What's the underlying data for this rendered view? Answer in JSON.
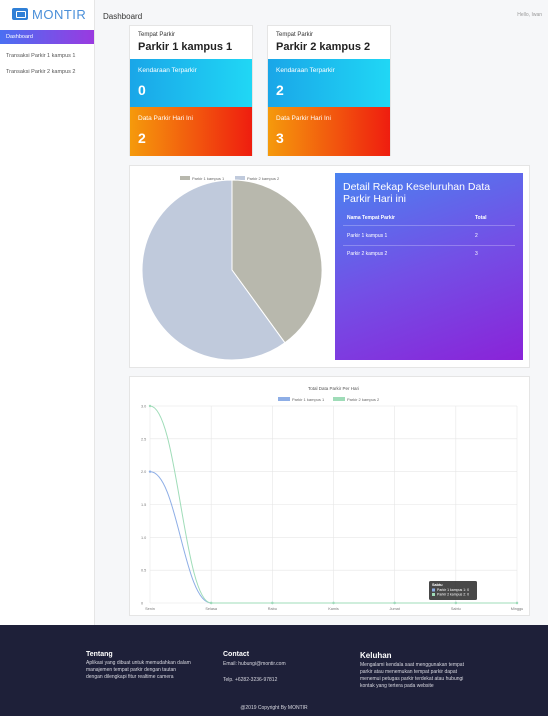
{
  "brand": {
    "name": "MONTIR"
  },
  "sidebar": {
    "items": [
      {
        "label": "Dashboard"
      },
      {
        "label": "Transaksi Parkir 1 kampus 1"
      },
      {
        "label": "Transaksi Parkir 2 kampus 2"
      }
    ]
  },
  "header": {
    "title": "Dashboard",
    "user": "Hello, Iwan"
  },
  "cards": [
    {
      "label": "Tempat Parkir",
      "name": "Parkir 1 kampus 1",
      "terparkir_label": "Kendaraan Terparkir",
      "terparkir": "0",
      "hari_ini_label": "Data Parkir Hari Ini",
      "hari_ini": "2"
    },
    {
      "label": "Tempat Parkir",
      "name": "Parkir 2 kampus 2",
      "terparkir_label": "Kendaraan Terparkir",
      "terparkir": "2",
      "hari_ini_label": "Data Parkir Hari Ini",
      "hari_ini": "3"
    }
  ],
  "rekap": {
    "title": "Detail Rekap Keseluruhan Data Parkir Hari ini",
    "col_name": "Nama Tempat Parkir",
    "col_total": "Total",
    "rows": [
      {
        "name": "Parkir 1 kampus 1",
        "total": "2"
      },
      {
        "name": "Parkir 2 kampus 2",
        "total": "3"
      }
    ]
  },
  "chart_data": [
    {
      "type": "pie",
      "categories": [
        "Parkir 1 kampus 1",
        "Parkir 2 kampus 2"
      ],
      "values": [
        2,
        3
      ],
      "colors": [
        "#b8b8ad",
        "#c0cadc"
      ],
      "legend": "top"
    },
    {
      "type": "line",
      "title": "Total Data Parkir Per Hari",
      "x": [
        "Senin",
        "Selasa",
        "Rabu",
        "Kamis",
        "Jumat",
        "Sabtu",
        "Minggu"
      ],
      "ylim": [
        0,
        3
      ],
      "yticks": [
        "0",
        "0.5",
        "1.0",
        "1.5",
        "2.0",
        "2.5",
        "3.0"
      ],
      "series": [
        {
          "name": "Parkir 1 kampus 1",
          "values": [
            2,
            0,
            0,
            0,
            0,
            0,
            0
          ],
          "color": "#8eaee6"
        },
        {
          "name": "Parkir 2 kampus 2",
          "values": [
            3,
            0,
            0,
            0,
            0,
            0,
            0
          ],
          "color": "#9fdcb8"
        }
      ],
      "tooltip": {
        "title": "Sabtu",
        "lines": [
          "Parkir 1 kampus 1: 0",
          "Parkir 2 kampus 2: 0"
        ]
      },
      "grid": true,
      "legend": "top"
    }
  ],
  "footer": {
    "tentang_title": "Tentang",
    "tentang_text": [
      "Aplikasi yang dibuat untuk memudahkan dalam",
      "manajemen tempat parkir dengan tautan",
      "dengan dilengkapi fitur realtime camera"
    ],
    "contact_title": "Contact",
    "email": "Email: hubungi@montir.com",
    "phone": "Telp. +6282-3236-97812",
    "keluhan_title": "Keluhan",
    "keluhan_text": [
      "Mengalami kendala saat menggunakan tempat",
      "parkir atau menemukan tempat parkir dapat",
      "menemui petugas parkir terdekat atau hubungi",
      "kontak yang tertera pada website"
    ],
    "copyright": "@2019 Copyright By MONTIR"
  }
}
